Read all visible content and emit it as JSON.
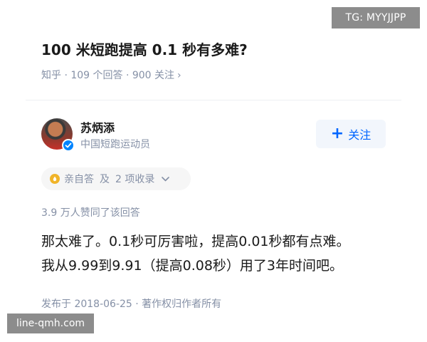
{
  "watermarks": {
    "top_right": "TG: MYYJJPP",
    "bottom_left": "line-qmh.com"
  },
  "question": {
    "title": "100 米短跑提高 0.1 秒有多难?",
    "meta": "知乎 · 109 个回答 · 900 关注",
    "chevron": "›"
  },
  "author": {
    "name": "苏炳添",
    "bio": "中国短跑运动员",
    "verified": true,
    "avatar_icon": "avatar-photo",
    "badge_icon": "verified-badge-icon"
  },
  "follow_button": {
    "icon": "+",
    "label": "关注"
  },
  "collection": {
    "self_answer": "亲自答",
    "separator": "及",
    "recorded": "2 项收录",
    "chevron": "⌄"
  },
  "likes_text": "3.9 万人赞同了该回答",
  "answer_lines": [
    "那太难了。0.1秒可厉害啦，提高0.01秒都有点难。",
    "我从9.99到9.91（提高0.08秒）用了3年时间吧。"
  ],
  "footer": "发布于 2018-06-25 · 著作权归作者所有",
  "colors": {
    "accent": "#0066ff",
    "meta_gray": "#8590a6",
    "badge_blue": "#0084ff",
    "coin": "#f0b429"
  }
}
